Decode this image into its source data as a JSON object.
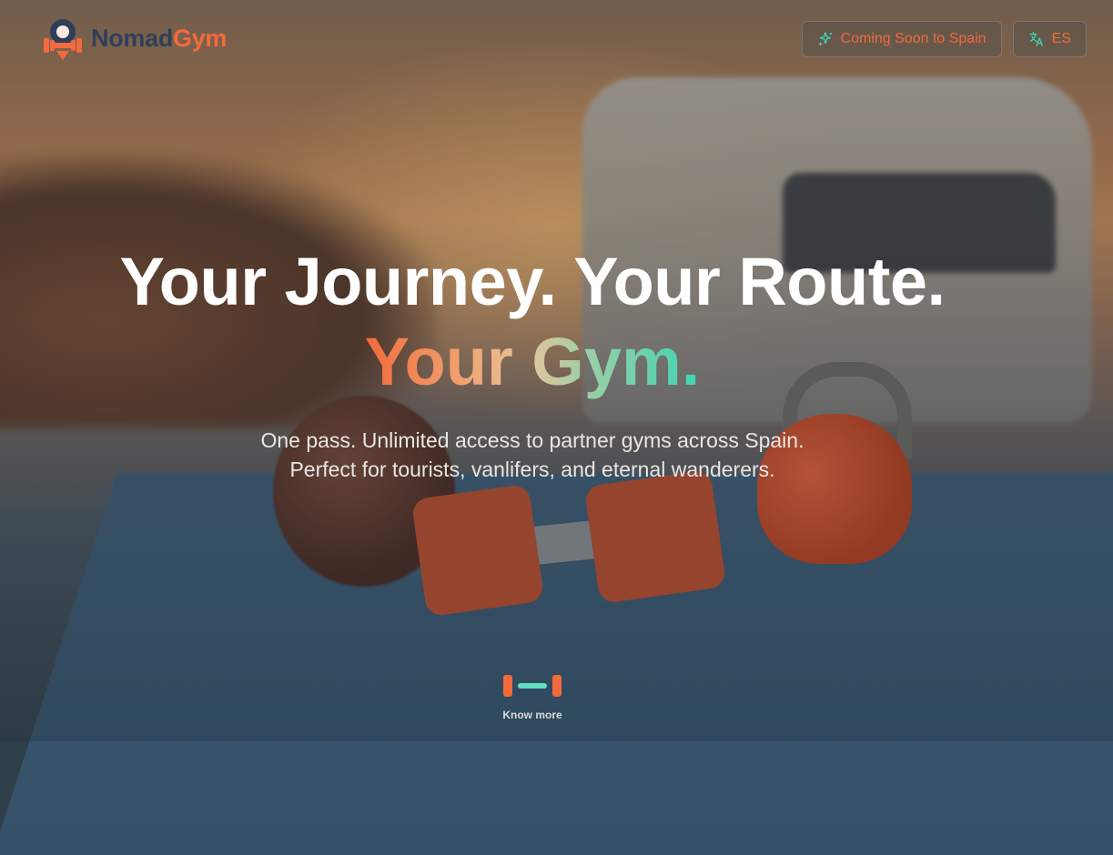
{
  "header": {
    "logo_nomad": "Nomad",
    "logo_gym": "Gym",
    "coming_soon_label": "Coming Soon to Spain",
    "coming_soon_icon": "sparkles-icon",
    "language_label": "ES",
    "language_icon": "translate-icon"
  },
  "hero": {
    "headline_line1": "Your Journey. Your Route.",
    "headline_line2": "Your Gym.",
    "subtitle_line1": "One pass. Unlimited access to partner gyms across Spain.",
    "subtitle_line2": "Perfect for tourists, vanlifers, and eternal wanderers."
  },
  "cta": {
    "know_more_label": "Know more",
    "know_more_icon": "dumbbell-icon"
  },
  "colors": {
    "accent_orange": "#f26a3d",
    "accent_teal": "#3ed4b1",
    "logo_dark": "#2f3f5a"
  }
}
